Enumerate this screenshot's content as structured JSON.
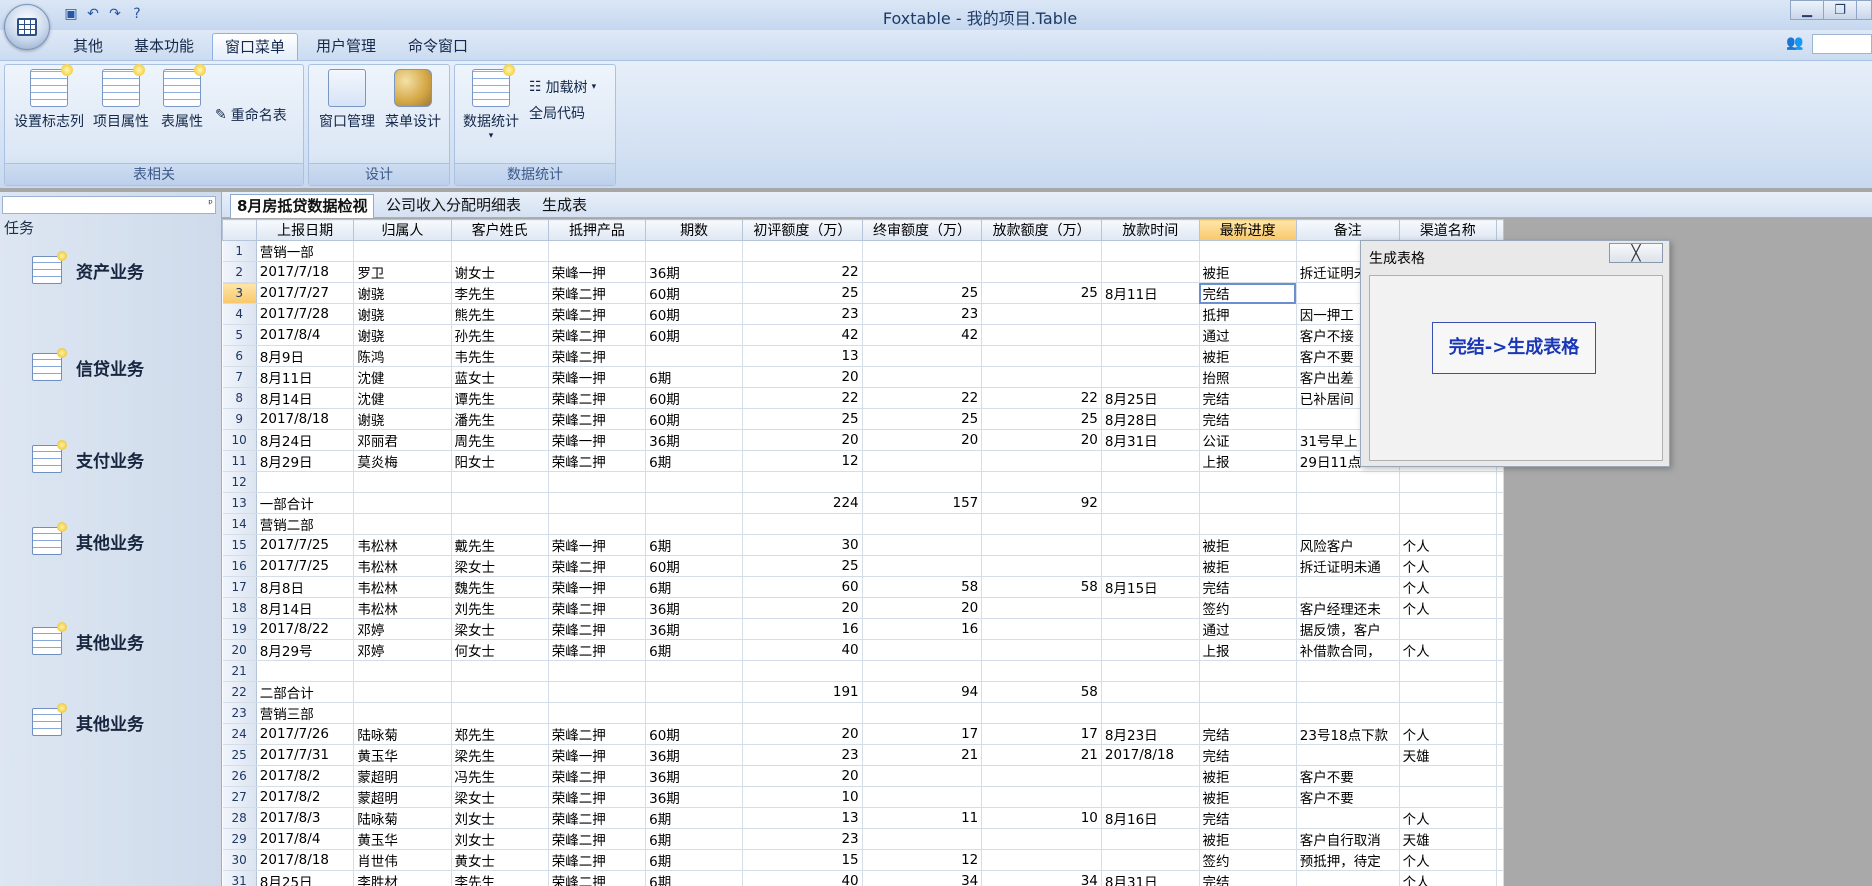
{
  "window": {
    "title": "Foxtable - 我的项目.Table"
  },
  "ribbon_tabs": [
    "其他",
    "基本功能",
    "窗口菜单",
    "用户管理",
    "命令窗口"
  ],
  "ribbon": {
    "groups": [
      {
        "caption": "表相关",
        "buttons": [
          "设置标志列",
          "项目属性",
          "表属性"
        ],
        "small": "重命名表"
      },
      {
        "caption": "设计",
        "buttons": [
          "窗口管理",
          "菜单设计"
        ]
      },
      {
        "caption": "数据统计",
        "buttons": [
          "数据统计"
        ],
        "small": [
          "加载树",
          "全局代码"
        ]
      }
    ]
  },
  "taskpane": {
    "header": "任务",
    "items": [
      "资产业务",
      "信贷业务",
      "支付业务",
      "其他业务",
      "其他业务",
      "其他业务"
    ]
  },
  "doc_tabs": [
    "8月房抵贷数据检视",
    "公司收入分配明细表",
    "生成表"
  ],
  "grid": {
    "columns": [
      "上报日期",
      "归属人",
      "客户姓氏",
      "抵押产品",
      "期数",
      "初评额度（万）",
      "终审额度（万）",
      "放款额度（万）",
      "放款时间",
      "最新进度",
      "备注",
      "渠道名称"
    ],
    "rows": [
      [
        "营销一部",
        "",
        "",
        "",
        "",
        "",
        "",
        "",
        "",
        "",
        "",
        ""
      ],
      [
        "2017/7/18",
        "罗卫",
        "谢女士",
        "荣峰一押",
        "36期",
        "22",
        "",
        "",
        "",
        "被拒",
        "拆迁证明未通",
        ""
      ],
      [
        "2017/7/27",
        "谢骁",
        "李先生",
        "荣峰二押",
        "60期",
        "25",
        "25",
        "25",
        "8月11日",
        "完结",
        "",
        ""
      ],
      [
        "2017/7/28",
        "谢骁",
        "熊先生",
        "荣峰二押",
        "60期",
        "23",
        "23",
        "",
        "",
        "抵押",
        "因一押工",
        ""
      ],
      [
        "2017/8/4",
        "谢骁",
        "孙先生",
        "荣峰二押",
        "60期",
        "42",
        "42",
        "",
        "",
        "通过",
        "客户不接",
        ""
      ],
      [
        "8月9日",
        "陈鸿",
        "韦先生",
        "荣峰二押",
        "",
        "13",
        "",
        "",
        "",
        "被拒",
        "客户不要",
        ""
      ],
      [
        "8月11日",
        "沈健",
        "蓝女士",
        "荣峰一押",
        "6期",
        "20",
        "",
        "",
        "",
        "抬照",
        "客户出差",
        ""
      ],
      [
        "8月14日",
        "沈健",
        "谭先生",
        "荣峰二押",
        "60期",
        "22",
        "22",
        "22",
        "8月25日",
        "完结",
        "已补居间",
        ""
      ],
      [
        "2017/8/18",
        "谢骁",
        "潘先生",
        "荣峰二押",
        "60期",
        "25",
        "25",
        "25",
        "8月28日",
        "完结",
        "",
        ""
      ],
      [
        "8月24日",
        "邓丽君",
        "周先生",
        "荣峰一押",
        "36期",
        "20",
        "20",
        "20",
        "8月31日",
        "公证",
        "31号早上",
        ""
      ],
      [
        "8月29日",
        "莫炎梅",
        "阳女士",
        "荣峰二押",
        "6期",
        "12",
        "",
        "",
        "",
        "上报",
        "29日11点",
        ""
      ],
      [
        "",
        "",
        "",
        "",
        "",
        "",
        "",
        "",
        "",
        "",
        "",
        ""
      ],
      [
        "一部合计",
        "",
        "",
        "",
        "",
        "224",
        "157",
        "92",
        "",
        "",
        "",
        ""
      ],
      [
        "营销二部",
        "",
        "",
        "",
        "",
        "",
        "",
        "",
        "",
        "",
        "",
        ""
      ],
      [
        "2017/7/25",
        "韦松林",
        "戴先生",
        "荣峰一押",
        "6期",
        "30",
        "",
        "",
        "",
        "被拒",
        "风险客户",
        "个人"
      ],
      [
        "2017/7/25",
        "韦松林",
        "梁女士",
        "荣峰二押",
        "60期",
        "25",
        "",
        "",
        "",
        "被拒",
        "拆迁证明未通",
        "个人"
      ],
      [
        "8月8日",
        "韦松林",
        "魏先生",
        "荣峰一押",
        "6期",
        "60",
        "58",
        "58",
        "8月15日",
        "完结",
        "",
        "个人"
      ],
      [
        "8月14日",
        "韦松林",
        "刘先生",
        "荣峰二押",
        "36期",
        "20",
        "20",
        "",
        "",
        "签约",
        "客户经理还未",
        "个人"
      ],
      [
        "2017/8/22",
        "邓婷",
        "梁女士",
        "荣峰二押",
        "36期",
        "16",
        "16",
        "",
        "",
        "通过",
        "据反馈，客户",
        ""
      ],
      [
        "8月29号",
        "邓婷",
        "何女士",
        "荣峰二押",
        "6期",
        "40",
        "",
        "",
        "",
        "上报",
        "补借款合同，",
        "个人"
      ],
      [
        "",
        "",
        "",
        "",
        "",
        "",
        "",
        "",
        "",
        "",
        "",
        ""
      ],
      [
        "二部合计",
        "",
        "",
        "",
        "",
        "191",
        "94",
        "58",
        "",
        "",
        "",
        ""
      ],
      [
        "营销三部",
        "",
        "",
        "",
        "",
        "",
        "",
        "",
        "",
        "",
        "",
        ""
      ],
      [
        "2017/7/26",
        "陆咏菊",
        "郑先生",
        "荣峰二押",
        "60期",
        "20",
        "17",
        "17",
        "8月23日",
        "完结",
        "23号18点下款",
        "个人"
      ],
      [
        "2017/7/31",
        "黄玉华",
        "梁先生",
        "荣峰一押",
        "36期",
        "23",
        "21",
        "21",
        "2017/8/18",
        "完结",
        "",
        "天雄"
      ],
      [
        "2017/8/2",
        "蒙超明",
        "冯先生",
        "荣峰二押",
        "36期",
        "20",
        "",
        "",
        "",
        "被拒",
        "客户不要",
        ""
      ],
      [
        "2017/8/2",
        "蒙超明",
        "梁女士",
        "荣峰二押",
        "36期",
        "10",
        "",
        "",
        "",
        "被拒",
        "客户不要",
        ""
      ],
      [
        "2017/8/3",
        "陆咏菊",
        "刘女士",
        "荣峰二押",
        "6期",
        "13",
        "11",
        "10",
        "8月16日",
        "完结",
        "",
        "个人"
      ],
      [
        "2017/8/4",
        "黄玉华",
        "刘女士",
        "荣峰二押",
        "6期",
        "23",
        "",
        "",
        "",
        "被拒",
        "客户自行取消",
        "天雄"
      ],
      [
        "2017/8/18",
        "肖世伟",
        "黄女士",
        "荣峰二押",
        "6期",
        "15",
        "12",
        "",
        "",
        "签约",
        "预抵押，待定",
        "个人"
      ],
      [
        "8月25日",
        "李胜材",
        "李先生",
        "荣峰二押",
        "6期",
        "40",
        "34",
        "34",
        "8月31日",
        "完结",
        "",
        "个人"
      ]
    ]
  },
  "float_window": {
    "title": "生成表格",
    "close_label": "╳",
    "button": "完结->生成表格"
  }
}
